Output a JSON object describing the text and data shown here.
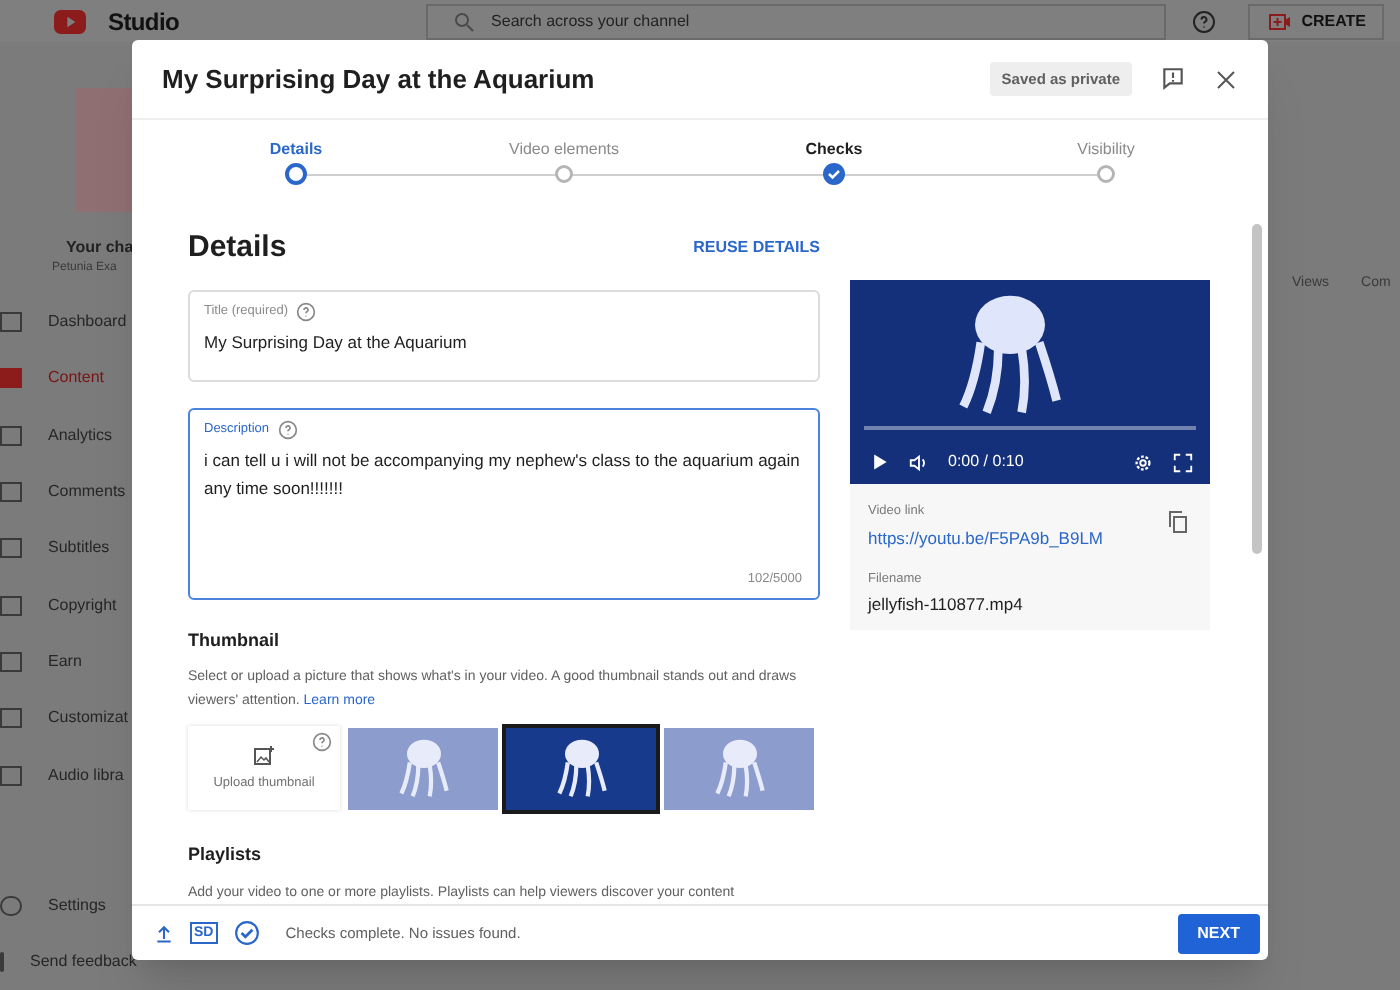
{
  "app_header": {
    "logo": "Studio",
    "search": {
      "placeholder": "Search across your channel"
    },
    "create_button": "CREATE"
  },
  "sidebar": {
    "channel_title": "Your cha",
    "channel_name": "Petunia Exa",
    "items": [
      {
        "label": "Dashboard",
        "selected": false
      },
      {
        "label": "Content",
        "selected": true
      },
      {
        "label": "Analytics",
        "selected": false
      },
      {
        "label": "Comments",
        "selected": false
      },
      {
        "label": "Subtitles",
        "selected": false
      },
      {
        "label": "Copyright",
        "selected": false
      },
      {
        "label": "Earn",
        "selected": false
      },
      {
        "label": "Customizat",
        "selected": false
      },
      {
        "label": "Audio libra",
        "selected": false
      }
    ],
    "bottom_items": [
      "Settings",
      "Send feedback"
    ]
  },
  "background_columns": [
    "Views",
    "Com"
  ],
  "dialog": {
    "title": "My Surprising Day at the Aquarium",
    "save_status": "Saved as private",
    "steps": [
      {
        "label": "Details",
        "selected": true,
        "done": false
      },
      {
        "label": "Video elements",
        "selected": false,
        "done": false
      },
      {
        "label": "Checks",
        "selected": false,
        "done": true
      },
      {
        "label": "Visibility",
        "selected": false,
        "done": false
      }
    ],
    "heading": "Details",
    "reuse_button": "REUSE DETAILS",
    "title_field": {
      "label": "Title (required)",
      "value": "My Surprising Day at the Aquarium",
      "focused": false
    },
    "description_field": {
      "label": "Description",
      "value": "i can tell u i will not be accompanying my nephew's class to the aquarium again any time soon!!!!!!!",
      "counter": "102/5000",
      "focused": true
    },
    "thumbnail": {
      "heading": "Thumbnail",
      "text": "Select or upload a picture that shows what's in your video. A good thumbnail stands out and draws viewers' attention.",
      "link": "Learn more",
      "upload_label": "Upload thumbnail",
      "options": [
        {
          "selected": false
        },
        {
          "selected": true
        },
        {
          "selected": false
        }
      ]
    },
    "playlists": {
      "heading": "Playlists",
      "text": "Add your video to one or more playlists. Playlists can help viewers discover your content"
    },
    "video": {
      "time": "0:00 / 0:10",
      "link_label": "Video link",
      "link": "https://youtu.be/F5PA9b_B9LM",
      "filename_label": "Filename",
      "filename": "jellyfish-110877.mp4"
    },
    "footer": {
      "quality_badge": "SD",
      "status": "Checks complete. No issues found.",
      "next_button": "NEXT"
    }
  }
}
